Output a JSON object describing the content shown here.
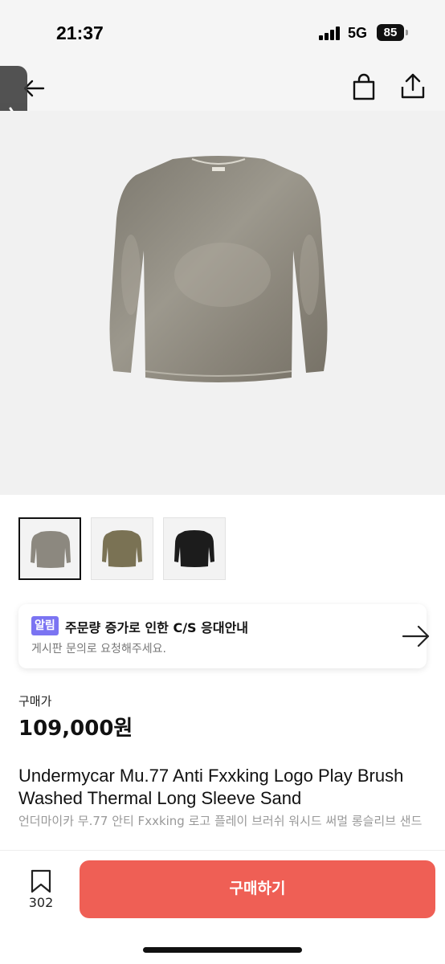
{
  "status_bar": {
    "time": "21:37",
    "network": "5G",
    "battery": "85"
  },
  "nav": {
    "back_icon": "back-arrow-icon",
    "bag_icon": "shopping-bag-icon",
    "share_icon": "share-icon"
  },
  "thumbnails": [
    {
      "name": "gray-sweatshirt",
      "selected": true
    },
    {
      "name": "olive-sweatshirt",
      "selected": false
    },
    {
      "name": "black-sweatshirt",
      "selected": false
    }
  ],
  "notice": {
    "badge": "알림",
    "title": "주문량 증가로 인한 C/S 응대안내",
    "subtitle": "게시판 문의로 요청해주세요."
  },
  "price": {
    "label": "구매가",
    "value": "109,000원"
  },
  "product": {
    "title_en": "Undermycar Mu.77 Anti Fxxking Logo Play Brush Washed Thermal Long Sleeve Sand",
    "title_ko": "언더마이카 무.77 안티 Fxxking 로고 플레이 브러쉬 워시드 써멀 롱슬리브 샌드"
  },
  "bottom_bar": {
    "wish_count": "302",
    "buy_label": "구매하기"
  },
  "colors": {
    "accent": "#ef5f55",
    "badge": "#7b74f2",
    "shirt_gray": "#8c887f",
    "shirt_olive": "#7a7254",
    "shirt_black": "#1c1c1c"
  }
}
